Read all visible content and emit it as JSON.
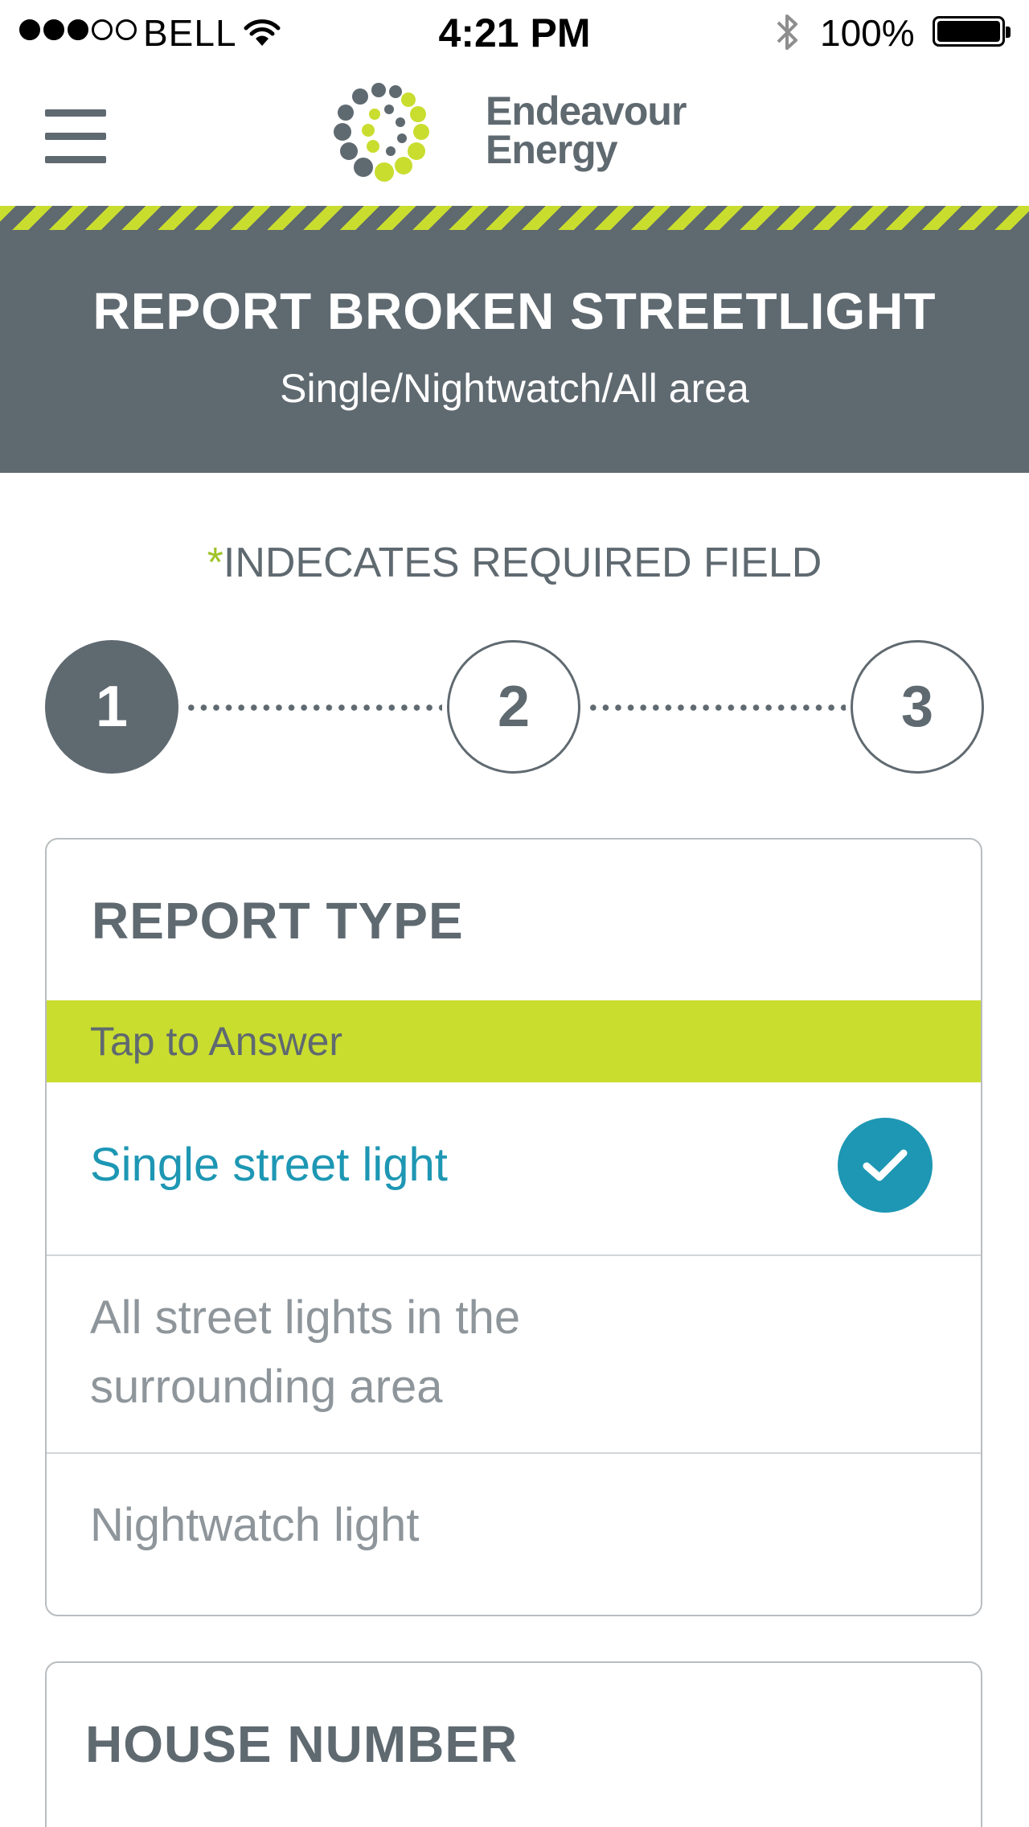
{
  "status_bar": {
    "carrier": "BELL",
    "time": "4:21 PM",
    "battery_percent": "100%",
    "signal_strength_of_5": 3
  },
  "header": {
    "logo_line1": "Endeavour",
    "logo_line2": "Energy",
    "menu_icon": "hamburger-icon"
  },
  "banner": {
    "title": "REPORT BROKEN STREETLIGHT",
    "subtitle": "Single/Nightwatch/All area"
  },
  "required_note": {
    "star": "*",
    "text": "INDECATES REQUIRED FIELD"
  },
  "stepper": {
    "steps": [
      "1",
      "2",
      "3"
    ],
    "active_step": 1
  },
  "report_type": {
    "title": "REPORT TYPE",
    "prompt": "Tap to Answer",
    "options": [
      "Single street light",
      "All street lights in the surrounding area",
      "Nightwatch light"
    ],
    "option2_line1": "All street lights in the",
    "option2_line2": "surrounding area",
    "selected_index": 0
  },
  "house_number": {
    "title": "HOUSE NUMBER"
  },
  "colors": {
    "slate": "#5f6970",
    "lime": "#c9dd2f",
    "teal": "#1d97b3",
    "muted_text": "#8e969b"
  }
}
